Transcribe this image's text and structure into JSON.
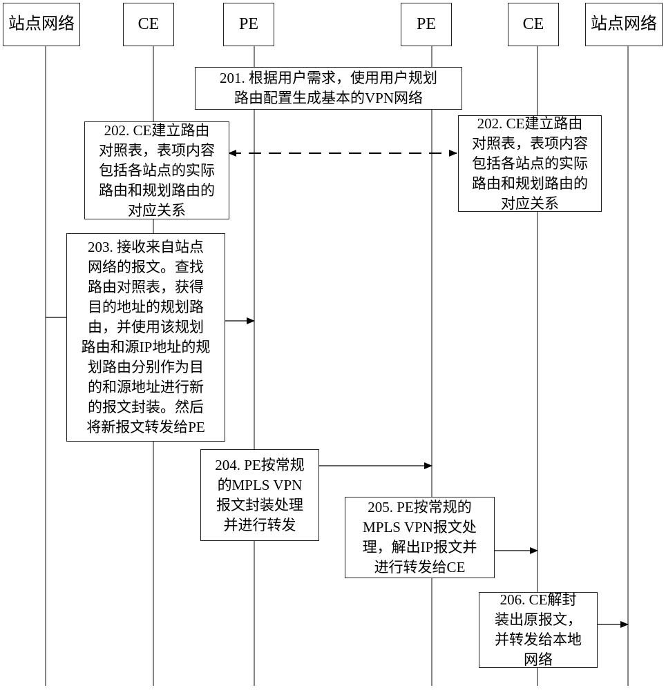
{
  "participants": [
    {
      "id": "site-left",
      "label": "站点网络"
    },
    {
      "id": "ce-left",
      "label": "CE"
    },
    {
      "id": "pe-left",
      "label": "PE"
    },
    {
      "id": "pe-right",
      "label": "PE"
    },
    {
      "id": "ce-right",
      "label": "CE"
    },
    {
      "id": "site-right",
      "label": "站点网络"
    }
  ],
  "steps": {
    "s201": "201. 根据用户需求，使用用户规划\n路由配置生成基本的VPN网络",
    "s202_left": "202. CE建立路由\n对照表，表项内容\n包括各站点的实际\n路由和规划路由的\n对应关系",
    "s202_right": "202. CE建立路由\n对照表，表项内容\n包括各站点的实际\n路由和规划路由的\n对应关系",
    "s203": "203. 接收来自站点\n网络的报文。查找\n路由对照表，获得\n目的地址的规划路\n由，并使用该规划\n路由和源IP地址的规\n划路由分别作为目\n的和源地址进行新\n的报文封装。然后\n将新报文转发给PE",
    "s204": "204. PE按常规\n的MPLS VPN\n报文封装处理\n并进行转发",
    "s205": "205. PE按常规的\nMPLS VPN报文处\n理，解出IP报文并\n进行转发给CE",
    "s206": "206. CE解封\n装出原报文，\n并转发给本地\n网络"
  },
  "messages": [
    {
      "from": "ce-left",
      "to": "ce-right",
      "style": "dashed",
      "bidirectional": true
    },
    {
      "from": "site-left",
      "to": "ce-left",
      "style": "solid",
      "arrow": false
    },
    {
      "from": "ce-left",
      "to": "pe-left",
      "style": "solid"
    },
    {
      "from": "pe-left",
      "to": "pe-right",
      "style": "solid"
    },
    {
      "from": "pe-right",
      "to": "ce-right",
      "style": "solid"
    },
    {
      "from": "ce-right",
      "to": "site-right",
      "style": "solid"
    }
  ]
}
